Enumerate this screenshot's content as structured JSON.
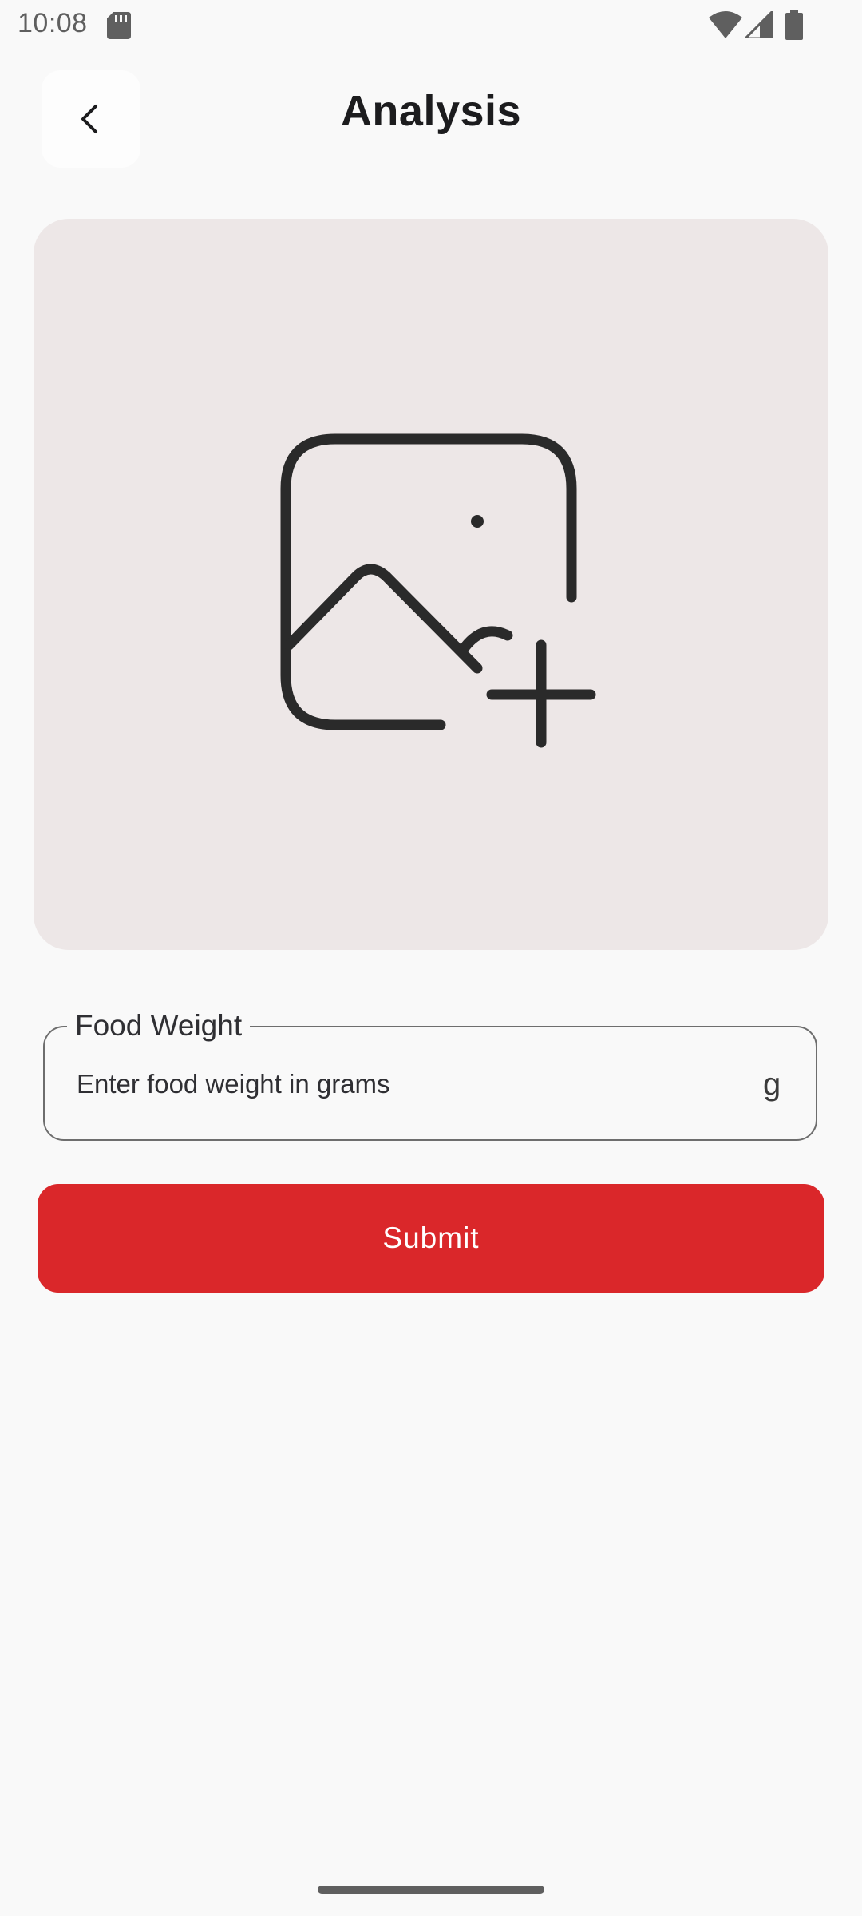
{
  "status_bar": {
    "time": "10:08",
    "icons": [
      "sd-card-icon",
      "wifi-icon",
      "cell-signal-icon",
      "battery-icon"
    ]
  },
  "header": {
    "title": "Analysis",
    "back_icon": "chevron-left-icon"
  },
  "image_picker": {
    "icon": "add-photo-icon"
  },
  "food_weight": {
    "label": "Food Weight",
    "placeholder": "Enter food weight in grams",
    "value": "",
    "suffix": "g"
  },
  "actions": {
    "submit_label": "Submit"
  },
  "colors": {
    "background": "#f9f9f9",
    "image_area": "#ede7e7",
    "primary": "#da272a",
    "outline": "#6e6e6e",
    "text": "#1c1c1e"
  }
}
